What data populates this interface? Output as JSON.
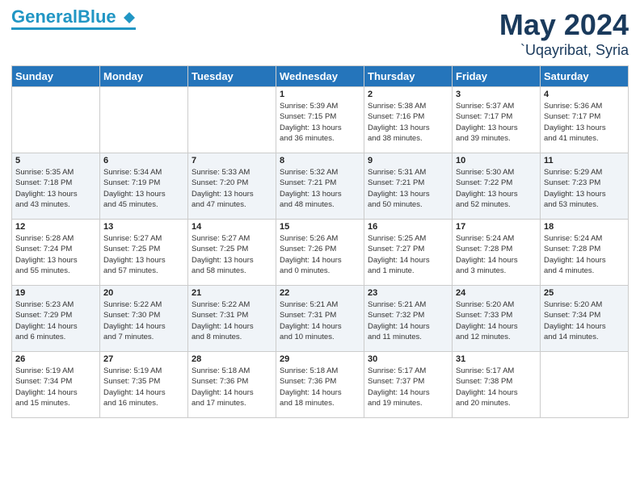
{
  "logo": {
    "part1": "General",
    "part2": "Blue"
  },
  "title": "May 2024",
  "location": "`Uqayribat, Syria",
  "weekdays": [
    "Sunday",
    "Monday",
    "Tuesday",
    "Wednesday",
    "Thursday",
    "Friday",
    "Saturday"
  ],
  "rows": [
    [
      {
        "day": "",
        "info": ""
      },
      {
        "day": "",
        "info": ""
      },
      {
        "day": "",
        "info": ""
      },
      {
        "day": "1",
        "info": "Sunrise: 5:39 AM\nSunset: 7:15 PM\nDaylight: 13 hours\nand 36 minutes."
      },
      {
        "day": "2",
        "info": "Sunrise: 5:38 AM\nSunset: 7:16 PM\nDaylight: 13 hours\nand 38 minutes."
      },
      {
        "day": "3",
        "info": "Sunrise: 5:37 AM\nSunset: 7:17 PM\nDaylight: 13 hours\nand 39 minutes."
      },
      {
        "day": "4",
        "info": "Sunrise: 5:36 AM\nSunset: 7:17 PM\nDaylight: 13 hours\nand 41 minutes."
      }
    ],
    [
      {
        "day": "5",
        "info": "Sunrise: 5:35 AM\nSunset: 7:18 PM\nDaylight: 13 hours\nand 43 minutes."
      },
      {
        "day": "6",
        "info": "Sunrise: 5:34 AM\nSunset: 7:19 PM\nDaylight: 13 hours\nand 45 minutes."
      },
      {
        "day": "7",
        "info": "Sunrise: 5:33 AM\nSunset: 7:20 PM\nDaylight: 13 hours\nand 47 minutes."
      },
      {
        "day": "8",
        "info": "Sunrise: 5:32 AM\nSunset: 7:21 PM\nDaylight: 13 hours\nand 48 minutes."
      },
      {
        "day": "9",
        "info": "Sunrise: 5:31 AM\nSunset: 7:21 PM\nDaylight: 13 hours\nand 50 minutes."
      },
      {
        "day": "10",
        "info": "Sunrise: 5:30 AM\nSunset: 7:22 PM\nDaylight: 13 hours\nand 52 minutes."
      },
      {
        "day": "11",
        "info": "Sunrise: 5:29 AM\nSunset: 7:23 PM\nDaylight: 13 hours\nand 53 minutes."
      }
    ],
    [
      {
        "day": "12",
        "info": "Sunrise: 5:28 AM\nSunset: 7:24 PM\nDaylight: 13 hours\nand 55 minutes."
      },
      {
        "day": "13",
        "info": "Sunrise: 5:27 AM\nSunset: 7:25 PM\nDaylight: 13 hours\nand 57 minutes."
      },
      {
        "day": "14",
        "info": "Sunrise: 5:27 AM\nSunset: 7:25 PM\nDaylight: 13 hours\nand 58 minutes."
      },
      {
        "day": "15",
        "info": "Sunrise: 5:26 AM\nSunset: 7:26 PM\nDaylight: 14 hours\nand 0 minutes."
      },
      {
        "day": "16",
        "info": "Sunrise: 5:25 AM\nSunset: 7:27 PM\nDaylight: 14 hours\nand 1 minute."
      },
      {
        "day": "17",
        "info": "Sunrise: 5:24 AM\nSunset: 7:28 PM\nDaylight: 14 hours\nand 3 minutes."
      },
      {
        "day": "18",
        "info": "Sunrise: 5:24 AM\nSunset: 7:28 PM\nDaylight: 14 hours\nand 4 minutes."
      }
    ],
    [
      {
        "day": "19",
        "info": "Sunrise: 5:23 AM\nSunset: 7:29 PM\nDaylight: 14 hours\nand 6 minutes."
      },
      {
        "day": "20",
        "info": "Sunrise: 5:22 AM\nSunset: 7:30 PM\nDaylight: 14 hours\nand 7 minutes."
      },
      {
        "day": "21",
        "info": "Sunrise: 5:22 AM\nSunset: 7:31 PM\nDaylight: 14 hours\nand 8 minutes."
      },
      {
        "day": "22",
        "info": "Sunrise: 5:21 AM\nSunset: 7:31 PM\nDaylight: 14 hours\nand 10 minutes."
      },
      {
        "day": "23",
        "info": "Sunrise: 5:21 AM\nSunset: 7:32 PM\nDaylight: 14 hours\nand 11 minutes."
      },
      {
        "day": "24",
        "info": "Sunrise: 5:20 AM\nSunset: 7:33 PM\nDaylight: 14 hours\nand 12 minutes."
      },
      {
        "day": "25",
        "info": "Sunrise: 5:20 AM\nSunset: 7:34 PM\nDaylight: 14 hours\nand 14 minutes."
      }
    ],
    [
      {
        "day": "26",
        "info": "Sunrise: 5:19 AM\nSunset: 7:34 PM\nDaylight: 14 hours\nand 15 minutes."
      },
      {
        "day": "27",
        "info": "Sunrise: 5:19 AM\nSunset: 7:35 PM\nDaylight: 14 hours\nand 16 minutes."
      },
      {
        "day": "28",
        "info": "Sunrise: 5:18 AM\nSunset: 7:36 PM\nDaylight: 14 hours\nand 17 minutes."
      },
      {
        "day": "29",
        "info": "Sunrise: 5:18 AM\nSunset: 7:36 PM\nDaylight: 14 hours\nand 18 minutes."
      },
      {
        "day": "30",
        "info": "Sunrise: 5:17 AM\nSunset: 7:37 PM\nDaylight: 14 hours\nand 19 minutes."
      },
      {
        "day": "31",
        "info": "Sunrise: 5:17 AM\nSunset: 7:38 PM\nDaylight: 14 hours\nand 20 minutes."
      },
      {
        "day": "",
        "info": ""
      }
    ]
  ]
}
